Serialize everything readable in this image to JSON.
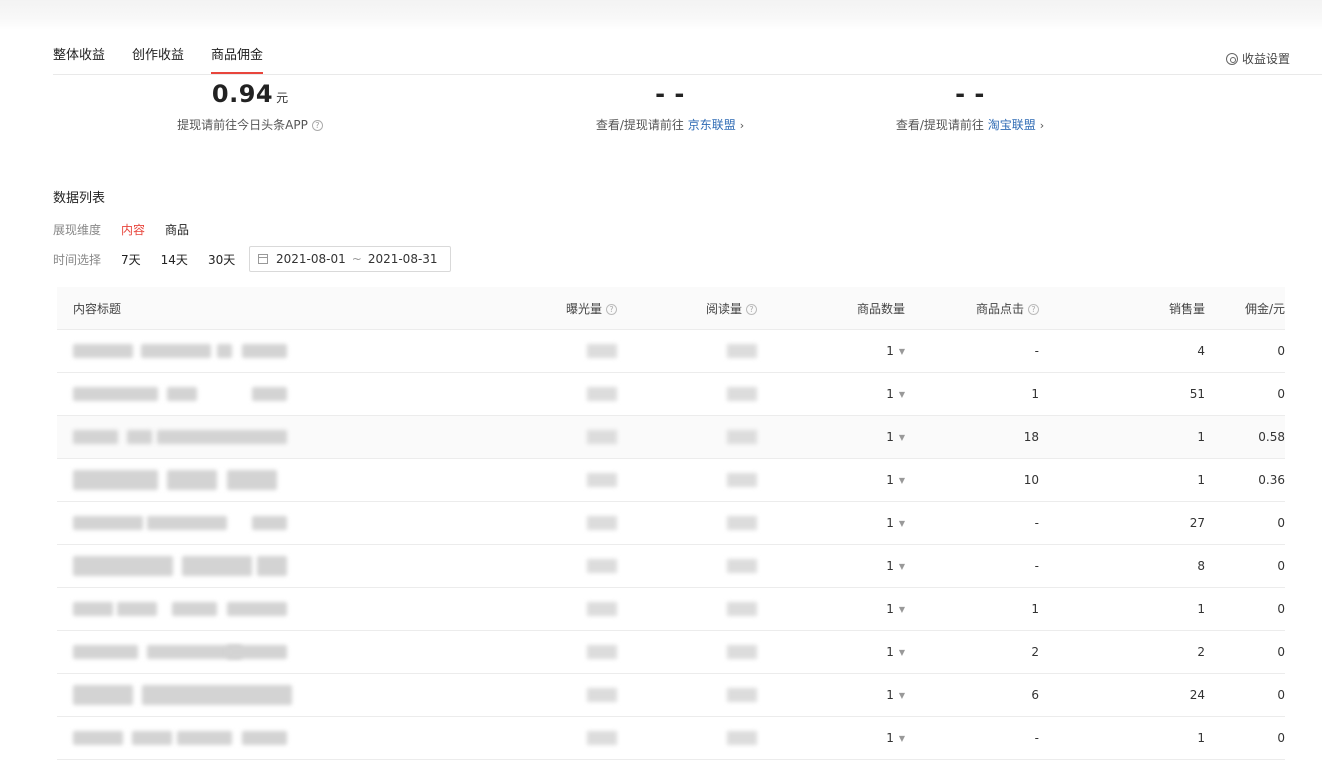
{
  "tabs": [
    {
      "label": "整体收益",
      "active": false
    },
    {
      "label": "创作收益",
      "active": false
    },
    {
      "label": "商品佣金",
      "active": true
    }
  ],
  "settings_label": "收益设置",
  "stats": [
    {
      "value": "0.94",
      "unit": "元",
      "desc": "提现请前往今日头条APP",
      "link": ""
    },
    {
      "value": "- -",
      "unit": "",
      "desc": "查看/提现请前往 ",
      "link": "京东联盟"
    },
    {
      "value": "- -",
      "unit": "",
      "desc": "查看/提现请前往 ",
      "link": "淘宝联盟"
    }
  ],
  "section_title": "数据列表",
  "dimension": {
    "label": "展现维度",
    "options": [
      "内容",
      "商品"
    ],
    "active": "内容"
  },
  "time": {
    "label": "时间选择",
    "options": [
      "7天",
      "14天",
      "30天"
    ]
  },
  "daterange": {
    "start": "2021-08-01",
    "sep": "~",
    "end": "2021-08-31"
  },
  "table": {
    "headers": {
      "title": "内容标题",
      "exposure": "曝光量",
      "reads": "阅读量",
      "goods": "商品数量",
      "clicks": "商品点击",
      "sales": "销售量",
      "commission": "佣金/元"
    },
    "rows": [
      {
        "goods": "1",
        "clicks": "-",
        "sales": "4",
        "commission": "0"
      },
      {
        "goods": "1",
        "clicks": "1",
        "sales": "51",
        "commission": "0"
      },
      {
        "goods": "1",
        "clicks": "18",
        "sales": "1",
        "commission": "0.58"
      },
      {
        "goods": "1",
        "clicks": "10",
        "sales": "1",
        "commission": "0.36"
      },
      {
        "goods": "1",
        "clicks": "-",
        "sales": "27",
        "commission": "0"
      },
      {
        "goods": "1",
        "clicks": "-",
        "sales": "8",
        "commission": "0"
      },
      {
        "goods": "1",
        "clicks": "1",
        "sales": "1",
        "commission": "0"
      },
      {
        "goods": "1",
        "clicks": "2",
        "sales": "2",
        "commission": "0"
      },
      {
        "goods": "1",
        "clicks": "6",
        "sales": "24",
        "commission": "0"
      },
      {
        "goods": "1",
        "clicks": "-",
        "sales": "1",
        "commission": "0"
      }
    ]
  },
  "colors": {
    "accent": "#e8453c",
    "link": "#2f6bb4"
  }
}
